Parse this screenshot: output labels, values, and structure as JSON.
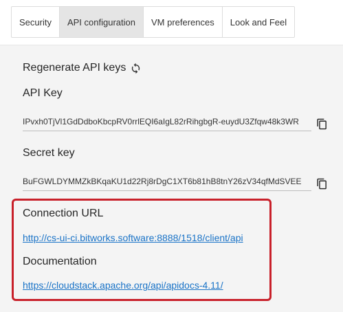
{
  "tabs": [
    {
      "label": "Security"
    },
    {
      "label": "API configuration"
    },
    {
      "label": "VM preferences"
    },
    {
      "label": "Look and Feel"
    }
  ],
  "regenerate": {
    "label": "Regenerate API keys",
    "icon": "refresh-icon"
  },
  "api_key": {
    "label": "API Key",
    "value": "IPvxh0TjVl1GdDdboKbcpRV0rrlEQI6aIgL82rRihgbgR-euydU3Zfqw48k3WR",
    "copy_icon": "copy-icon"
  },
  "secret_key": {
    "label": "Secret key",
    "value": "BuFGWLDYMMZkBKqaKU1d22Rj8rDgC1XT6b81hB8tnY26zV34qfMdSVEE",
    "copy_icon": "copy-icon"
  },
  "connection": {
    "label": "Connection URL",
    "url": "http://cs-ui-ci.bitworks.software:8888/1518/client/api"
  },
  "documentation": {
    "label": "Documentation",
    "url": "https://cloudstack.apache.org/api/apidocs-4.11/"
  },
  "colors": {
    "link": "#1a73c7",
    "highlight": "#c8202a",
    "panel_bg": "#f4f4f4",
    "active_tab": "#e5e5e5"
  }
}
